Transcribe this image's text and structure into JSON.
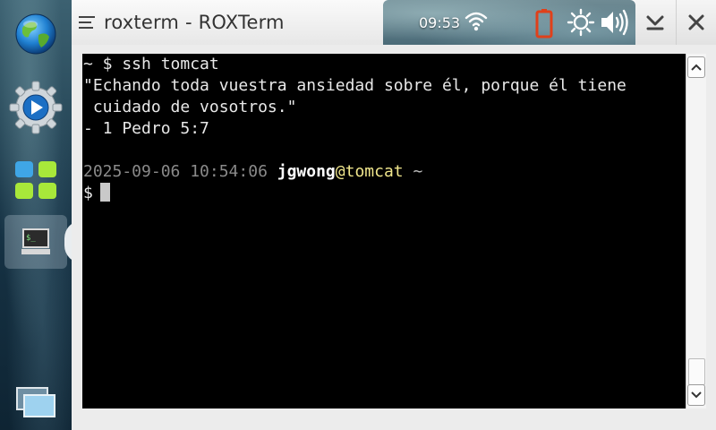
{
  "window": {
    "title": "roxterm - ROXTerm"
  },
  "status": {
    "clock": "09:53"
  },
  "sidebar": {
    "items": [
      {
        "name": "browser",
        "icon": "globe-icon"
      },
      {
        "name": "media-player",
        "icon": "play-gear-icon"
      },
      {
        "name": "app-menu",
        "icon": "app-grid-icon"
      },
      {
        "name": "terminal",
        "icon": "terminal-icon",
        "active": true
      },
      {
        "name": "task-switcher",
        "icon": "windows-stack-icon"
      }
    ]
  },
  "terminal": {
    "line1": "~ $ ssh tomcat",
    "line2": "\"Echando toda vuestra ansiedad sobre él, porque él tiene",
    "line3": " cuidado de vosotros.\"",
    "line4": "- 1 Pedro 5:7",
    "prompt_date": "2025-09-06 10:54:06",
    "prompt_user": "jgwong",
    "prompt_at": "@",
    "prompt_host": "tomcat",
    "prompt_dir": "~",
    "prompt_symbol": "$"
  },
  "colors": {
    "terminal_bg": "#000000",
    "host_color": "#f0e68c",
    "battery_color": "#e0401a"
  }
}
